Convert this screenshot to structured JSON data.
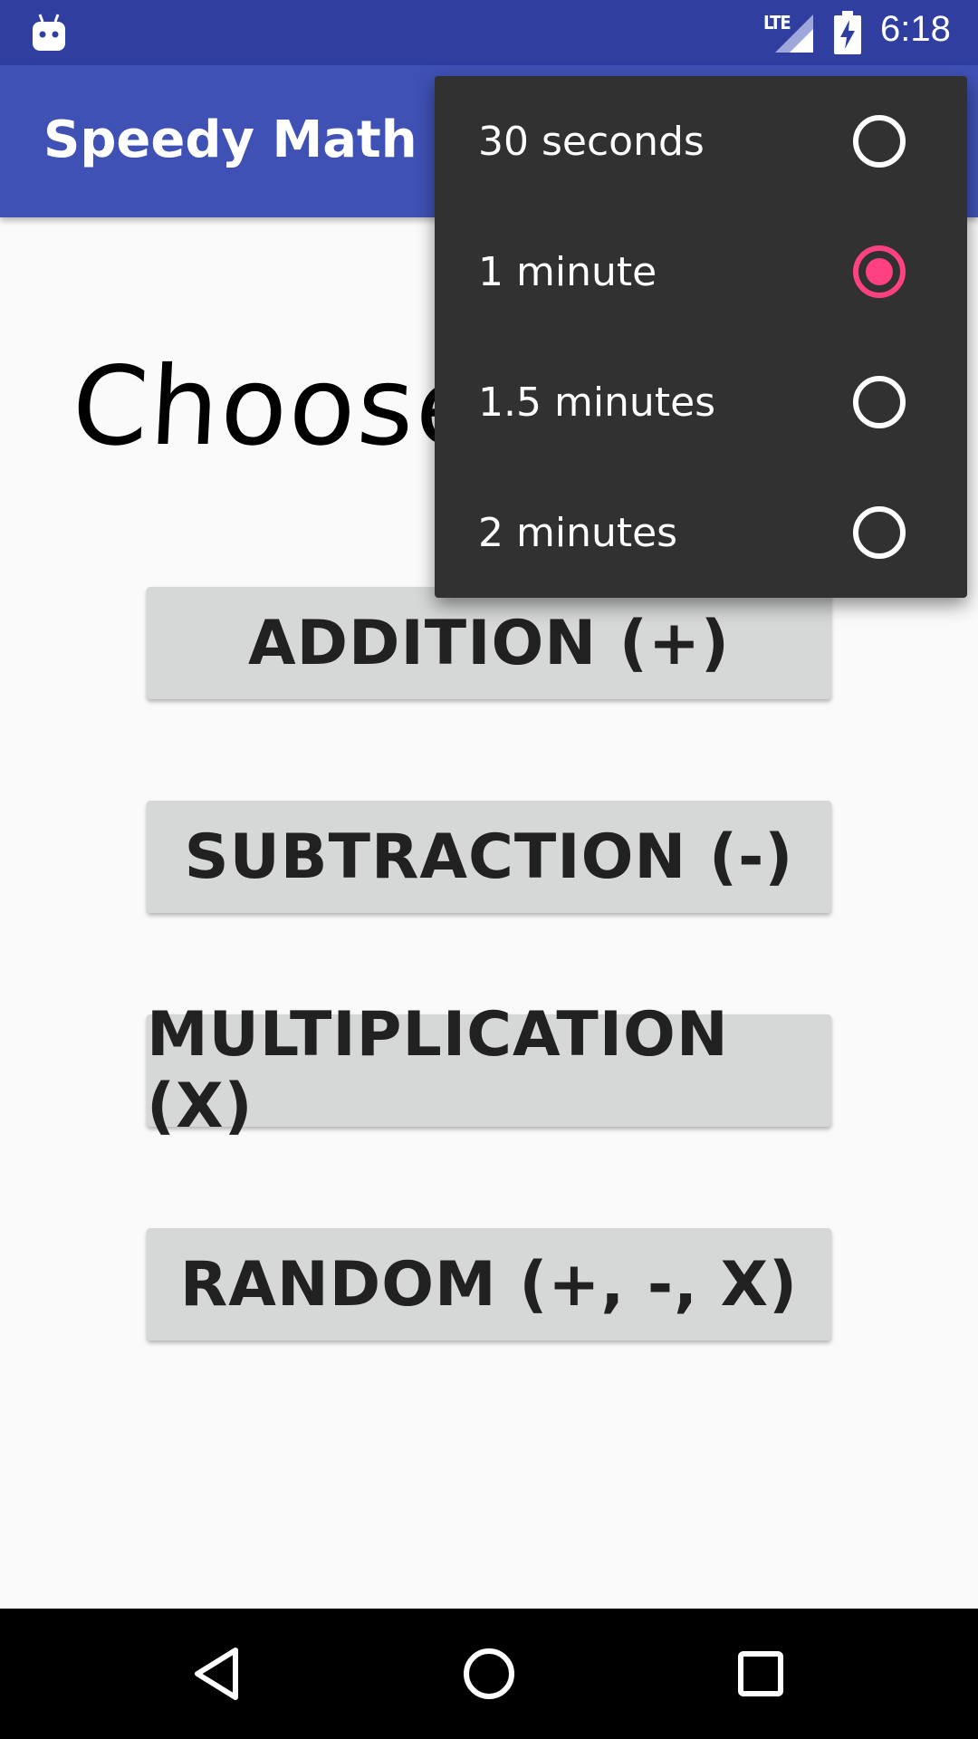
{
  "status_bar": {
    "network_label": "LTE",
    "time": "6:18",
    "icons": [
      "android-debug-icon",
      "signal-icon",
      "battery-charging-icon"
    ]
  },
  "app_bar": {
    "title": "Speedy Math",
    "color": "#3f51b5"
  },
  "main": {
    "heading": "Choose",
    "buttons": [
      {
        "label": "ADDITION (+)"
      },
      {
        "label": "SUBTRACTION (-)"
      },
      {
        "label": "MULTIPLICATION (X)"
      },
      {
        "label": "RANDOM (+, -, X)"
      }
    ]
  },
  "time_menu": {
    "options": [
      {
        "label": "30 seconds",
        "selected": false
      },
      {
        "label": "1 minute",
        "selected": true
      },
      {
        "label": "1.5 minutes",
        "selected": false
      },
      {
        "label": "2 minutes",
        "selected": false
      }
    ],
    "accent_color": "#ff4081"
  },
  "nav_bar": {
    "icons": [
      "back-icon",
      "home-icon",
      "recents-icon"
    ]
  }
}
